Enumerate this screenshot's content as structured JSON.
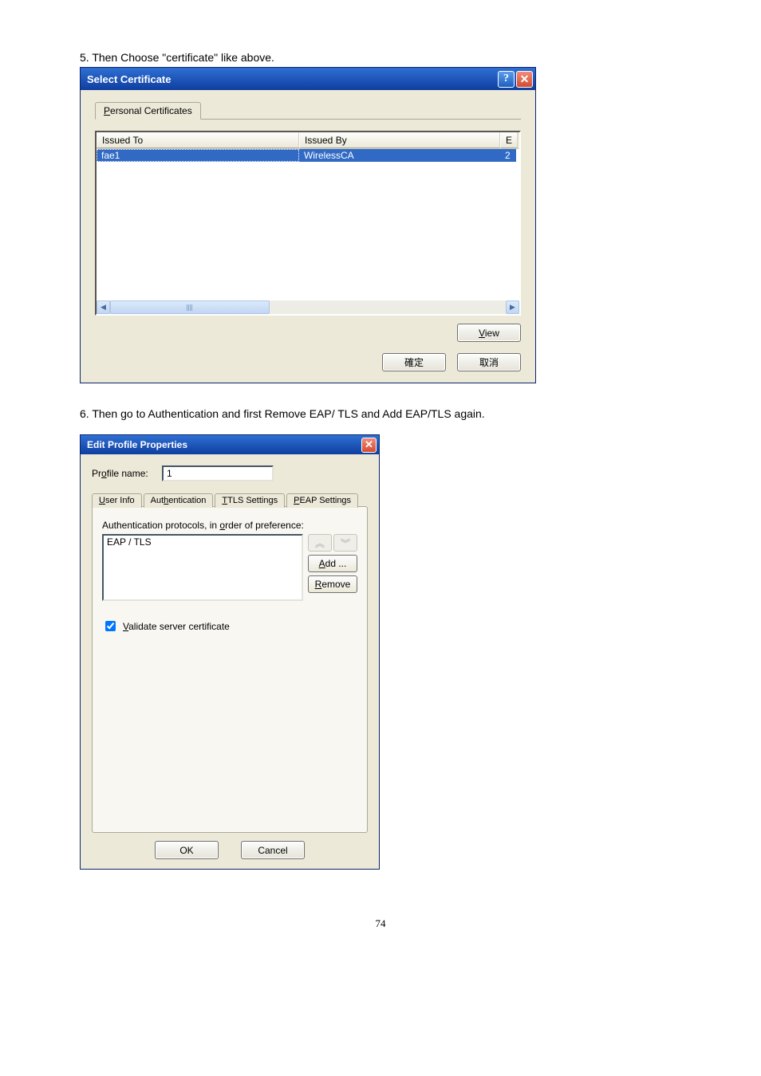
{
  "page": {
    "step5": "5. Then Choose \"certificate\" like above.",
    "step6": "6. Then go to Authentication and first Remove EAP/ TLS and Add EAP/TLS again.",
    "number": "74"
  },
  "dlg1": {
    "title": "Select Certificate",
    "tab_personal": "Personal Certificates",
    "col_issued_to": "Issued To",
    "col_issued_by": "Issued By",
    "col_e": "E",
    "row0_to": "fae1",
    "row0_by": "WirelessCA",
    "row0_e": "2",
    "btn_view": "View",
    "btn_ok": "確定",
    "btn_cancel": "取消"
  },
  "dlg2": {
    "title": "Edit Profile Properties",
    "profile_name_label": "Profile name:",
    "profile_name_value": "1",
    "tab_user": "User Info",
    "tab_auth": "Authentication",
    "tab_ttls": "TTLS Settings",
    "tab_peap": "PEAP Settings",
    "auth_label": "Authentication protocols, in order of preference:",
    "proto0": "EAP / TLS",
    "btn_add": "Add ...",
    "btn_remove": "Remove",
    "chk_validate": "Validate server certificate",
    "btn_ok": "OK",
    "btn_cancel": "Cancel"
  }
}
